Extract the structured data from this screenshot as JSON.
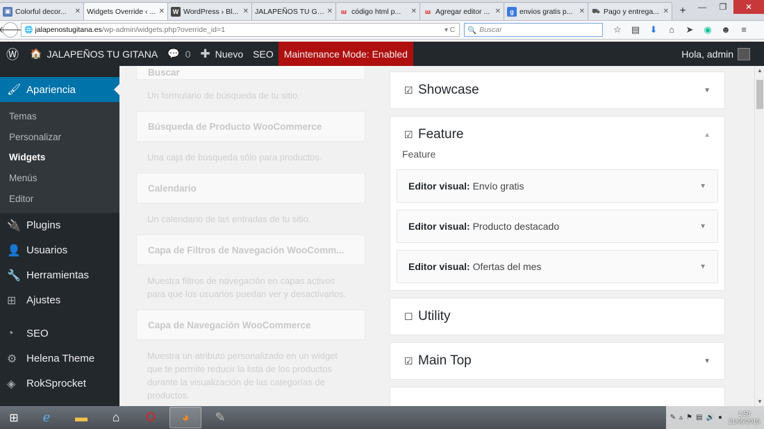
{
  "browser": {
    "tabs": [
      {
        "label": "Colorful decor...",
        "icon": "image-icon",
        "color": "#5a7fb8",
        "active": false
      },
      {
        "label": "Widgets Override ‹ ...",
        "icon": "page-icon",
        "color": "#ffffff",
        "active": true
      },
      {
        "label": "WordPress › Bl...",
        "icon": "wordpress-icon",
        "color": "#464646",
        "active": false
      },
      {
        "label": "JALAPEÑOS TU GI...",
        "icon": "page-icon",
        "color": "#ffffff",
        "active": false
      },
      {
        "label": "código html p...",
        "icon": "w-icon",
        "color": "#d11",
        "active": false
      },
      {
        "label": "Agregar editor ...",
        "icon": "w-icon",
        "color": "#d11",
        "active": false
      },
      {
        "label": "envios gratis p...",
        "icon": "google-icon",
        "color": "#3b7be0",
        "active": false
      },
      {
        "label": "Pago y entrega...",
        "icon": "cart-icon",
        "color": "#555",
        "active": false
      }
    ],
    "new_tab": "+",
    "url_host": "jalapenostugitana.es",
    "url_path": "/wp-admin/widgets.php?override_id=1",
    "search_placeholder": "Buscar"
  },
  "adminbar": {
    "site_name": "JALAPEÑOS TU GITANA",
    "comments_count": "0",
    "new_label": "Nuevo",
    "seo_label": "SEO",
    "maintenance_label": "Maintenance Mode: Enabled",
    "greeting": "Hola, admin",
    "maintenance_color": "#b00f0f"
  },
  "sidebar": {
    "current": {
      "label": "Apariencia",
      "icon": "paintbrush-icon"
    },
    "submenu": [
      {
        "label": "Temas",
        "current": false
      },
      {
        "label": "Personalizar",
        "current": false
      },
      {
        "label": "Widgets",
        "current": true
      },
      {
        "label": "Menús",
        "current": false
      },
      {
        "label": "Editor",
        "current": false
      }
    ],
    "items": [
      {
        "label": "Plugins",
        "icon": "plug-icon"
      },
      {
        "label": "Usuarios",
        "icon": "user-icon"
      },
      {
        "label": "Herramientas",
        "icon": "wrench-icon"
      },
      {
        "label": "Ajustes",
        "icon": "settings-icon"
      },
      {
        "label": "SEO",
        "icon": "seo-icon"
      },
      {
        "label": "Helena Theme",
        "icon": "gear-icon"
      },
      {
        "label": "RokSprocket",
        "icon": "rocket-icon"
      }
    ]
  },
  "available_widgets": [
    {
      "title": "Buscar",
      "desc": "Un formulario de búsqueda de tu sitio."
    },
    {
      "title": "Búsqueda de Producto WooCommerce",
      "desc": "Una caja de búsqueda sólo para productos."
    },
    {
      "title": "Calendario",
      "desc": "Un calendario de las entradas de tu sitio."
    },
    {
      "title": "Capa de Filtros de Navegación WooComm...",
      "desc": "Muestra filtros de navegación en capas activos para que los usuarios puedan ver y desactivarlos."
    },
    {
      "title": "Capa de Navegación WooCommerce",
      "desc": "Muestra un atributo personalizado en un widget que te permite reducir la lista de los productos durante la visualización de las categorías de productos."
    }
  ],
  "widget_areas": {
    "showcase": {
      "title": "Showcase",
      "checked": "☑"
    },
    "feature": {
      "title": "Feature",
      "checked": "☑",
      "description": "Feature",
      "widgets": [
        {
          "type": "Editor visual:",
          "name": "Envío gratis"
        },
        {
          "type": "Editor visual:",
          "name": "Producto destacado"
        },
        {
          "type": "Editor visual:",
          "name": "Ofertas del mes"
        }
      ]
    },
    "utility": {
      "title": "Utility",
      "checked": "☐"
    },
    "main_top": {
      "title": "Main Top",
      "checked": "☑"
    }
  },
  "taskbar": {
    "time": "1:50",
    "date": "21/05/2015"
  }
}
